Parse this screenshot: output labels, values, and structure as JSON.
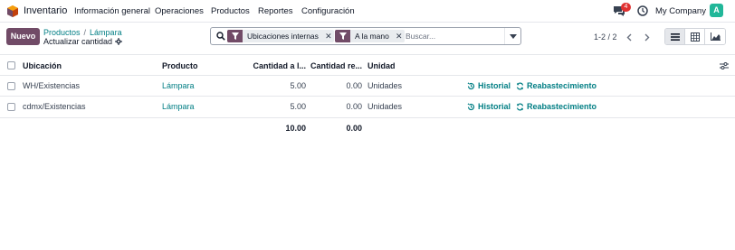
{
  "navbar": {
    "app_name": "Inventario",
    "menu": [
      "Información general",
      "Operaciones",
      "Productos",
      "Reportes",
      "Configuración"
    ],
    "chat_count": "4",
    "company": "My Company",
    "avatar_letter": "A",
    "icons": [
      "app-logo-icon",
      "chat-icon",
      "clock-icon"
    ]
  },
  "control": {
    "new_label": "Nuevo",
    "breadcrumb": [
      "Productos",
      "Lámpara"
    ],
    "breadcrumb_sep": "/",
    "subtitle": "Actualizar cantidad",
    "search": {
      "facets": [
        "Ubicaciones internas",
        "A la mano"
      ],
      "placeholder": "Buscar..."
    },
    "pager": "1-2 / 2"
  },
  "table": {
    "headers": [
      "Ubicación",
      "Producto",
      "Cantidad a l...",
      "Cantidad re...",
      "Unidad"
    ],
    "rows": [
      {
        "location": "WH/Existencias",
        "product": "Lámpara",
        "on_hand": "5.00",
        "reserved": "0.00",
        "unit": "Unidades",
        "history": "Historial",
        "replenish": "Reabastecimiento"
      },
      {
        "location": "cdmx/Existencias",
        "product": "Lámpara",
        "on_hand": "5.00",
        "reserved": "0.00",
        "unit": "Unidades",
        "history": "Historial",
        "replenish": "Reabastecimiento"
      }
    ],
    "totals": {
      "on_hand": "10.00",
      "reserved": "0.00"
    }
  },
  "colors": {
    "brand": "#714b67",
    "link": "#017e84",
    "avatar": "#21b799",
    "badge": "#e03131"
  }
}
